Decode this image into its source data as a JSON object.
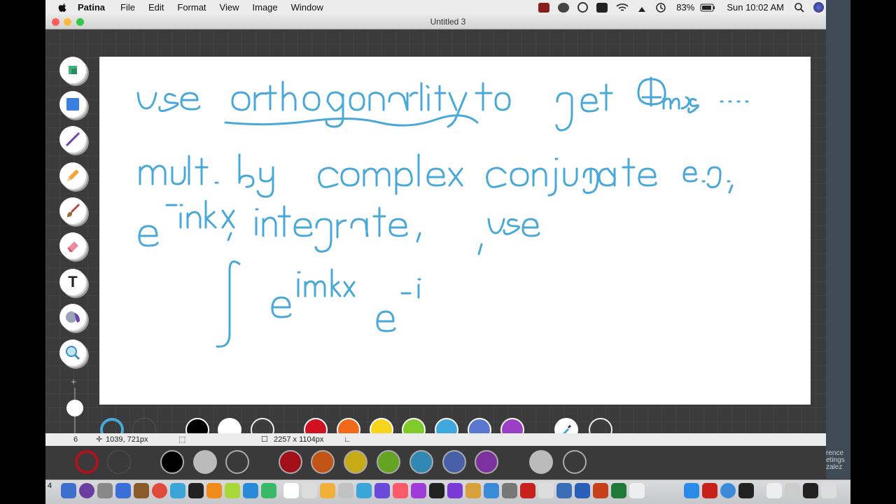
{
  "menubar": {
    "app_name": "Patina",
    "menus": [
      "File",
      "Edit",
      "Format",
      "View",
      "Image",
      "Window"
    ],
    "battery": "83%",
    "clock": "Sun 10:02 AM"
  },
  "window": {
    "title": "Untitled 3"
  },
  "statusbar": {
    "brush_size": "6",
    "cursor_pos": "1039, 721px",
    "canvas_size": "2257 x 1104px"
  },
  "tools": [
    {
      "name": "layers-icon"
    },
    {
      "name": "shape-icon"
    },
    {
      "name": "line-icon"
    },
    {
      "name": "pencil-icon"
    },
    {
      "name": "brush-icon"
    },
    {
      "name": "eraser-icon"
    },
    {
      "name": "text-icon",
      "label": "T"
    },
    {
      "name": "fill-icon"
    },
    {
      "name": "zoom-icon"
    }
  ],
  "palette_colors": [
    "#000000",
    "#ffffff",
    "hollow",
    "#d0111f",
    "#f06a1a",
    "#f7d51c",
    "#7ecb2a",
    "#3fa9df",
    "#5a78d0",
    "#9b3ec6"
  ],
  "handwriting_color": "#4aa8d8",
  "handwriting_lines": [
    "use orthogonality to get Φm's ...",
    "mult. by complex conjugate e.g.,",
    "e^-inkx, integrate, use",
    "∫ e^imkx e^-i"
  ],
  "dock": {
    "badge": "4"
  },
  "side_peek_text": [
    "rence",
    "etings",
    "zalez"
  ]
}
